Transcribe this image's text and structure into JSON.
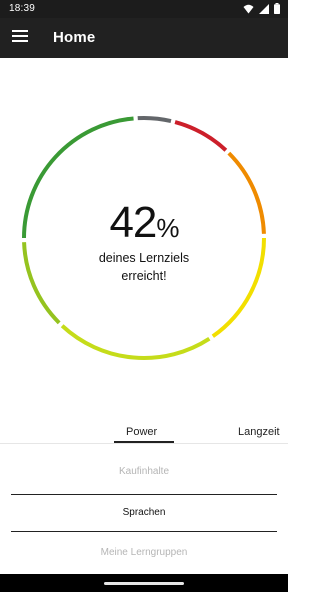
{
  "status_bar": {
    "time": "18:39",
    "icons": [
      "wifi-icon",
      "signal-icon",
      "battery-icon"
    ]
  },
  "app_bar": {
    "title": "Home",
    "menu_icon": "hamburger-menu-icon"
  },
  "progress": {
    "value": "42",
    "unit": "%",
    "fraction": 0.42,
    "caption_line1": "deines Lernziels",
    "caption_line2": "erreicht!",
    "segment_colors": [
      "#63666a",
      "#cc1f2a",
      "#ef8b00",
      "#f2df00",
      "#c5dc1a",
      "#95c31f",
      "#3a9a35"
    ]
  },
  "tabs": {
    "items": [
      {
        "label": "Power",
        "active": true
      },
      {
        "label": "Langzeit",
        "active": false
      }
    ]
  },
  "list": {
    "items": [
      {
        "label": "Kaufinhalte",
        "active": false
      },
      {
        "label": "Sprachen",
        "active": true
      },
      {
        "label": "Meine Lerngruppen",
        "active": false
      }
    ]
  }
}
